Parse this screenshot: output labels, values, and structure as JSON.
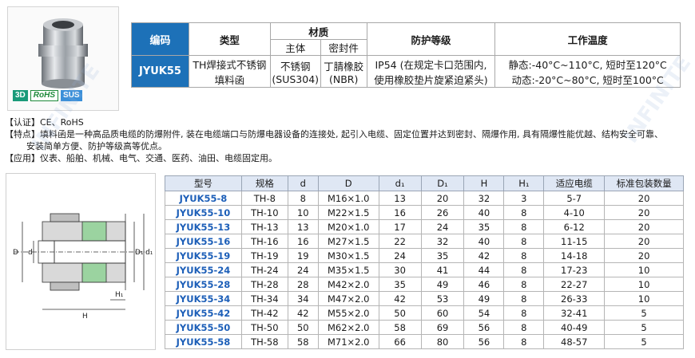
{
  "badges": [
    "3D",
    "RoHS",
    "SUS"
  ],
  "spec": {
    "h_code": "编码",
    "h_type": "类型",
    "h_material": "材质",
    "h_body": "主体",
    "h_seal": "密封件",
    "h_protection": "防护等级",
    "h_temp": "工作温度",
    "code": "JYUK55",
    "type_line1": "TH焊接式不锈钢",
    "type_line2": "填料函",
    "body_line1": "不锈钢",
    "body_line2": "(SUS304)",
    "seal_line1": "丁腈橡胶",
    "seal_line2": "(NBR)",
    "prot_line1": "IP54 (在规定卡口范围内,",
    "prot_line2": "使用橡胶垫片旋紧迫紧头)",
    "temp_line1": "静态:-40°C~110°C, 短时至120°C",
    "temp_line2": "动态:-20°C~80°C, 短时至100°C"
  },
  "notes": {
    "cert": "【认证】CE、RoHS",
    "feature1": "【特点】填料函是一种高品质电缆的防爆附件, 装在电缆端口与防爆电器设备的连接处, 起引入电缆、固定位置并达到密封、隔爆作用, 具有隔爆性能优越、结构安全可靠、",
    "feature2": "安装简单方便、防护等级高等优点。",
    "application": "【应用】仪表、船舶、机械、电气、交通、医药、油田、电缆固定用。"
  },
  "diagram": {
    "label_D": "D",
    "label_d": "d",
    "label_D1": "D₁",
    "label_d1": "d₁",
    "label_H": "H",
    "label_H1": "H₁"
  },
  "table": {
    "headers": [
      "型号",
      "规格",
      "d",
      "D",
      "d₁",
      "D₁",
      "H",
      "H₁",
      "适应电缆",
      "标准包装数量"
    ],
    "rows": [
      [
        "JYUK55-8",
        "TH-8",
        "8",
        "M16×1.0",
        "13",
        "20",
        "32",
        "3",
        "5-7",
        "20"
      ],
      [
        "JYUK55-10",
        "TH-10",
        "10",
        "M22×1.5",
        "16",
        "26",
        "40",
        "8",
        "4-10",
        "20"
      ],
      [
        "JYUK55-13",
        "TH-13",
        "13",
        "M20×1.0",
        "17",
        "24",
        "35",
        "8",
        "6-12",
        "20"
      ],
      [
        "JYUK55-16",
        "TH-16",
        "16",
        "M27×1.5",
        "22",
        "32",
        "40",
        "8",
        "11-15",
        "20"
      ],
      [
        "JYUK55-19",
        "TH-19",
        "19",
        "M30×1.5",
        "24",
        "35",
        "42",
        "8",
        "14-18",
        "20"
      ],
      [
        "JYUK55-24",
        "TH-24",
        "24",
        "M35×1.5",
        "30",
        "41",
        "44",
        "8",
        "17-23",
        "10"
      ],
      [
        "JYUK55-28",
        "TH-28",
        "28",
        "M42×2.0",
        "35",
        "49",
        "46",
        "8",
        "22-27",
        "10"
      ],
      [
        "JYUK55-34",
        "TH-34",
        "34",
        "M47×2.0",
        "42",
        "53",
        "49",
        "8",
        "26-33",
        "10"
      ],
      [
        "JYUK55-42",
        "TH-42",
        "42",
        "M55×2.0",
        "50",
        "60",
        "54",
        "8",
        "32-41",
        "5"
      ],
      [
        "JYUK55-50",
        "TH-50",
        "50",
        "M62×2.0",
        "58",
        "69",
        "56",
        "8",
        "40-49",
        "5"
      ],
      [
        "JYUK55-58",
        "TH-58",
        "58",
        "M71×2.0",
        "66",
        "80",
        "56",
        "8",
        "48-57",
        "5"
      ]
    ]
  },
  "colors": {
    "header_blue": "#1d71b8",
    "model_blue": "#1d5fb8",
    "table_header_bg": "#dfe7f4"
  }
}
